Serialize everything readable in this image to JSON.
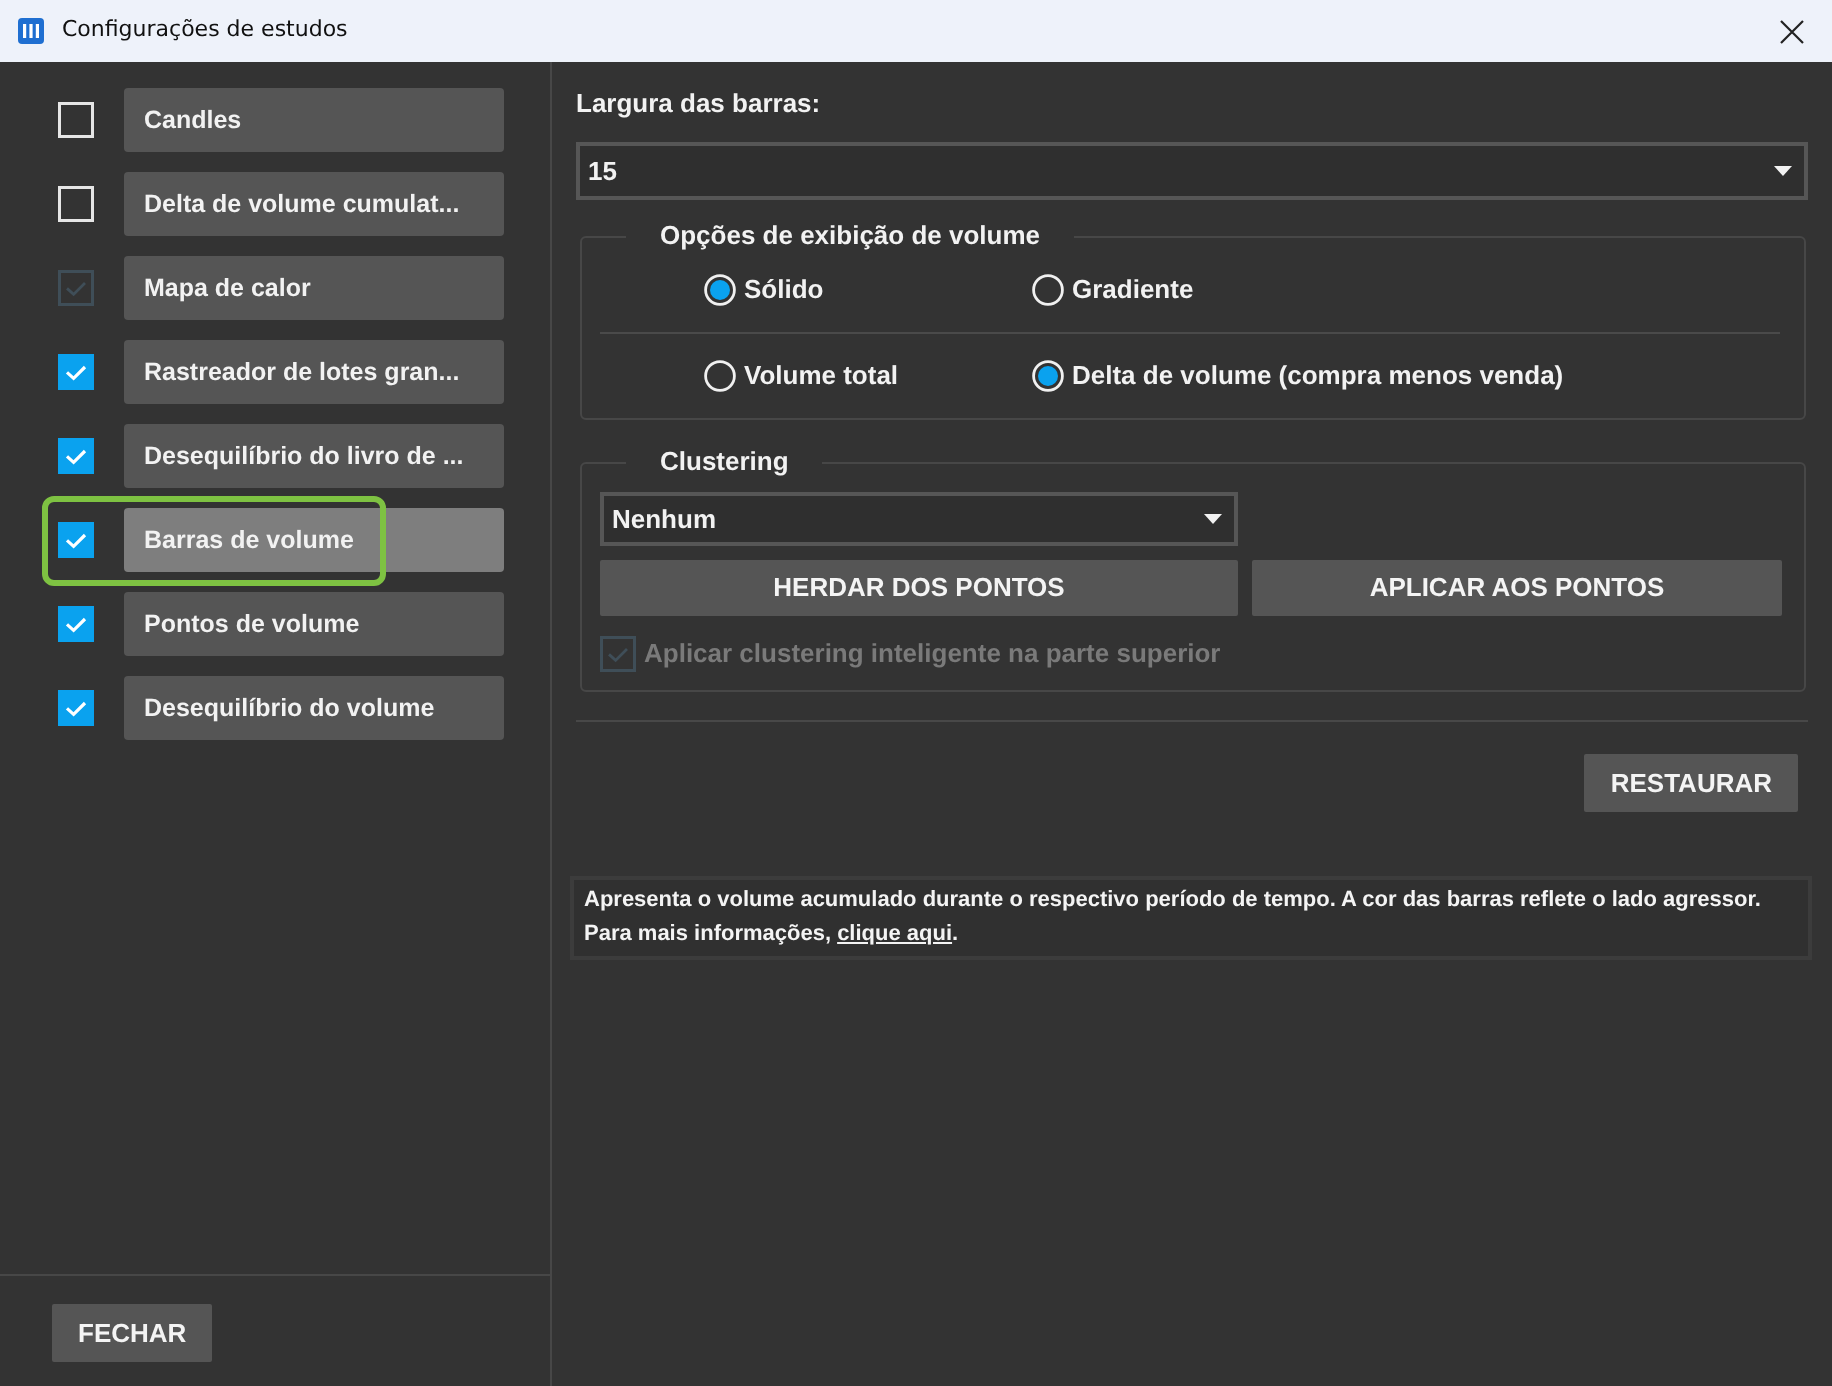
{
  "window": {
    "title": "Configurações de estudos"
  },
  "studies": [
    {
      "label": "Candles",
      "checked": false,
      "disabled": false,
      "selected": false
    },
    {
      "label": "Delta de volume cumulat...",
      "checked": false,
      "disabled": false,
      "selected": false
    },
    {
      "label": "Mapa de calor",
      "checked": true,
      "disabled": true,
      "selected": false
    },
    {
      "label": "Rastreador de lotes gran...",
      "checked": true,
      "disabled": false,
      "selected": false
    },
    {
      "label": "Desequilíbrio do livro de ...",
      "checked": true,
      "disabled": false,
      "selected": false
    },
    {
      "label": "Barras de volume",
      "checked": true,
      "disabled": false,
      "selected": true
    },
    {
      "label": "Pontos de volume",
      "checked": true,
      "disabled": false,
      "selected": false
    },
    {
      "label": "Desequilíbrio do volume",
      "checked": true,
      "disabled": false,
      "selected": false
    }
  ],
  "close_button": "FECHAR",
  "bar_width": {
    "label": "Largura das barras:",
    "value": "15"
  },
  "volume_display": {
    "title": "Opções de exibição de volume",
    "style_options": [
      {
        "label": "Sólido",
        "selected": true
      },
      {
        "label": "Gradiente",
        "selected": false
      }
    ],
    "mode_options": [
      {
        "label": "Volume total",
        "selected": false
      },
      {
        "label": "Delta de volume (compra menos venda)",
        "selected": true
      }
    ]
  },
  "clustering": {
    "title": "Clustering",
    "value": "Nenhum",
    "buttons": [
      "HERDAR DOS PONTOS",
      "APLICAR AOS PONTOS"
    ],
    "smart_option": {
      "label": "Aplicar clustering inteligente na parte superior",
      "checked": true,
      "disabled": true
    }
  },
  "reset_button": "RESTAURAR",
  "info": {
    "text": "Apresenta o volume acumulado durante o respectivo período de tempo. A cor das barras reflete o lado agressor.",
    "more_text": "Para mais informações, ",
    "link": "clique aqui",
    "end": "."
  }
}
